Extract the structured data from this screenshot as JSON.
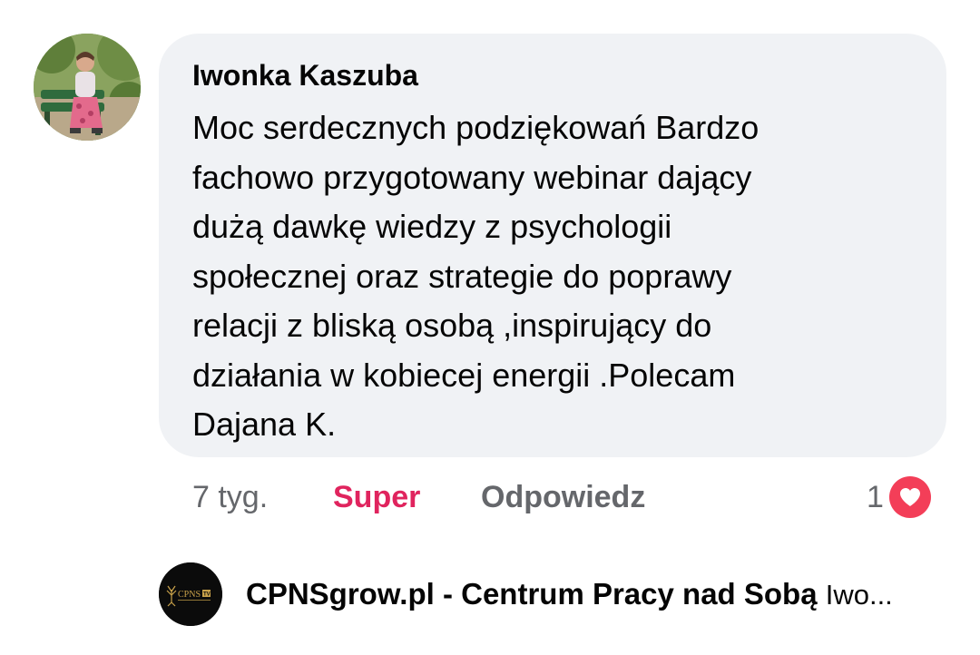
{
  "comment": {
    "author": "Iwonka Kaszuba",
    "text_lines": [
      "Moc serdecznych podziękowań Bardzo",
      "fachowo przygotowany webinar dający",
      "dużą dawkę wiedzy z psychologii",
      "społecznej oraz strategie do poprawy",
      "relacji z bliską osobą ,inspirujący do",
      "działania w kobiecej energii .Polecam",
      "Dajana K."
    ],
    "time": "7 tyg.",
    "reaction_label": "Super",
    "reply_label": "Odpowiedz",
    "reaction_count": "1",
    "reaction_icon": "heart-icon",
    "reaction_color": "#f33e58",
    "reaction_label_color": "#e0245e"
  },
  "reply": {
    "author": "CPNSgrow.pl - Centrum Pracy nad Sobą",
    "preview": "Iwo...",
    "avatar_logo_text": "CPNS",
    "avatar_logo_badge": "TV"
  },
  "colors": {
    "bubble_background": "#f0f2f5",
    "secondary_text": "#65676b"
  }
}
